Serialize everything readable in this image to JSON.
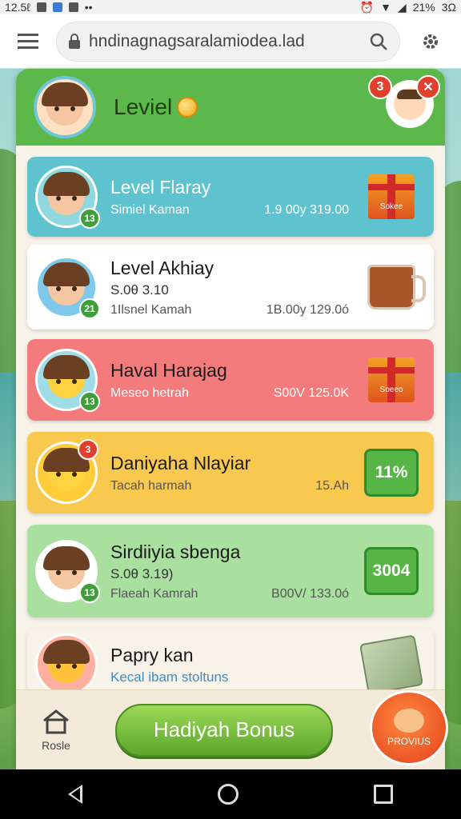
{
  "status_bar": {
    "time": "12.5ℓ",
    "battery": "21%",
    "extra": "3Ω"
  },
  "browser": {
    "url": "hndinagnagsaralamiodea.lad"
  },
  "header": {
    "title": "Leviel",
    "notification_count": "3",
    "icons": [
      "menu-icon",
      "lock-icon",
      "search-icon",
      "gear-icon",
      "coin-icon"
    ]
  },
  "cards": [
    {
      "title": "Level Flaray",
      "subtitle": "",
      "left": "Simiel Kaman",
      "right": "1.9 00y 319.00",
      "badge": "13",
      "reward": "gift",
      "reward_label": "Sokee",
      "color": "#5fc3cf"
    },
    {
      "title": "Level Akhiay",
      "subtitle": "S.0θ 3.10",
      "left": "1Ilsnel Kamah",
      "right": "1B.00y 129.0ó",
      "badge": "21",
      "reward": "mug",
      "reward_label": "",
      "color": "#ffffff"
    },
    {
      "title": "Haval Harajag",
      "subtitle": "",
      "left": "Meseo hetrah",
      "right": "S00V 125.0K",
      "badge": "13",
      "reward": "gift",
      "reward_label": "Soeeo",
      "color": "#f47b7b"
    },
    {
      "title": "Daniyaha Nlayiar",
      "subtitle": "",
      "left": "Tacah harmah",
      "right": "15.Ah",
      "badge": "3",
      "reward": "value",
      "reward_label": "11%",
      "color": "#f9c84e"
    },
    {
      "title": "Sirdiiyia sbenga",
      "subtitle": "S.0θ 3.19)",
      "left": "Flaeah Kamrah",
      "right": "B00V/ 133.0ó",
      "badge": "13",
      "reward": "value",
      "reward_label": "3004",
      "color": "#a9e0a0"
    },
    {
      "title": "Papry kan",
      "subtitle": "Kecal ibam stoltuns",
      "left": "",
      "right": "",
      "badge": "",
      "reward": "money",
      "reward_label": "",
      "color": "#f7f3e9"
    }
  ],
  "bottom": {
    "home_label": "Rosle",
    "bonus_button": "Hadiyah Bonus",
    "bonus_badge": "PROVIUS"
  }
}
